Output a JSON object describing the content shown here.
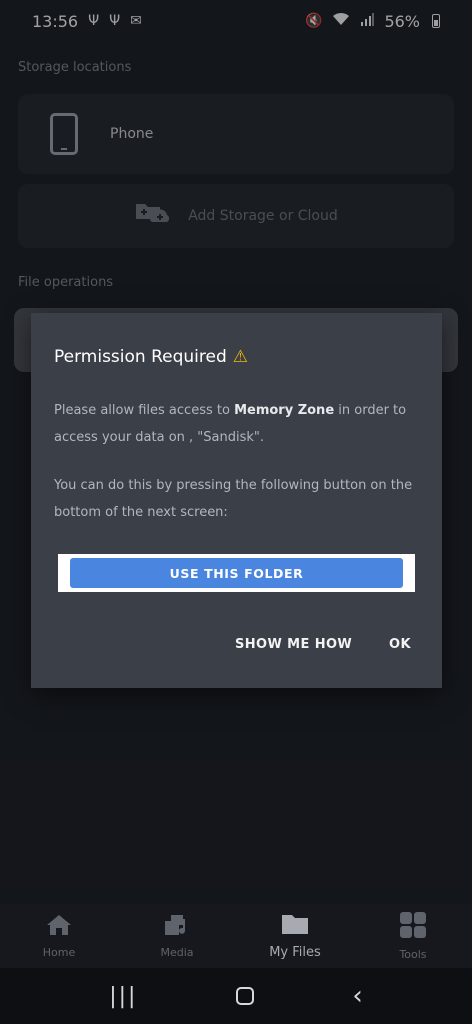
{
  "status": {
    "time": "13:56",
    "left_icons": [
      "usb-icon",
      "usb-icon",
      "message-icon"
    ],
    "right_icons": [
      "mute-icon",
      "wifi-icon",
      "signal-icon"
    ],
    "battery": "56%"
  },
  "storage": {
    "section_label": "Storage locations",
    "phone_label": "Phone",
    "add_label": "Add Storage or Cloud"
  },
  "file_ops": {
    "section_label": "File operations"
  },
  "dialog": {
    "title": "Permission Required",
    "p1_pre": "Please allow files access to ",
    "p1_bold": "Memory Zone",
    "p1_post": " in order to access your data on , \"Sandisk\".",
    "p2": "You can do this by pressing the following button on the bottom of the next screen:",
    "folder_button": "USE THIS FOLDER",
    "show_me_how": "SHOW ME HOW",
    "ok": "OK"
  },
  "nav": {
    "items": [
      {
        "label": "Home",
        "icon": "home-icon"
      },
      {
        "label": "Media",
        "icon": "media-icon"
      },
      {
        "label": "My Files",
        "icon": "folder-icon",
        "active": true
      },
      {
        "label": "Tools",
        "icon": "grid-icon"
      }
    ]
  },
  "colors": {
    "accent": "#4a86e0",
    "warning": "#f2b705",
    "dialog_bg": "#3b3f48"
  }
}
